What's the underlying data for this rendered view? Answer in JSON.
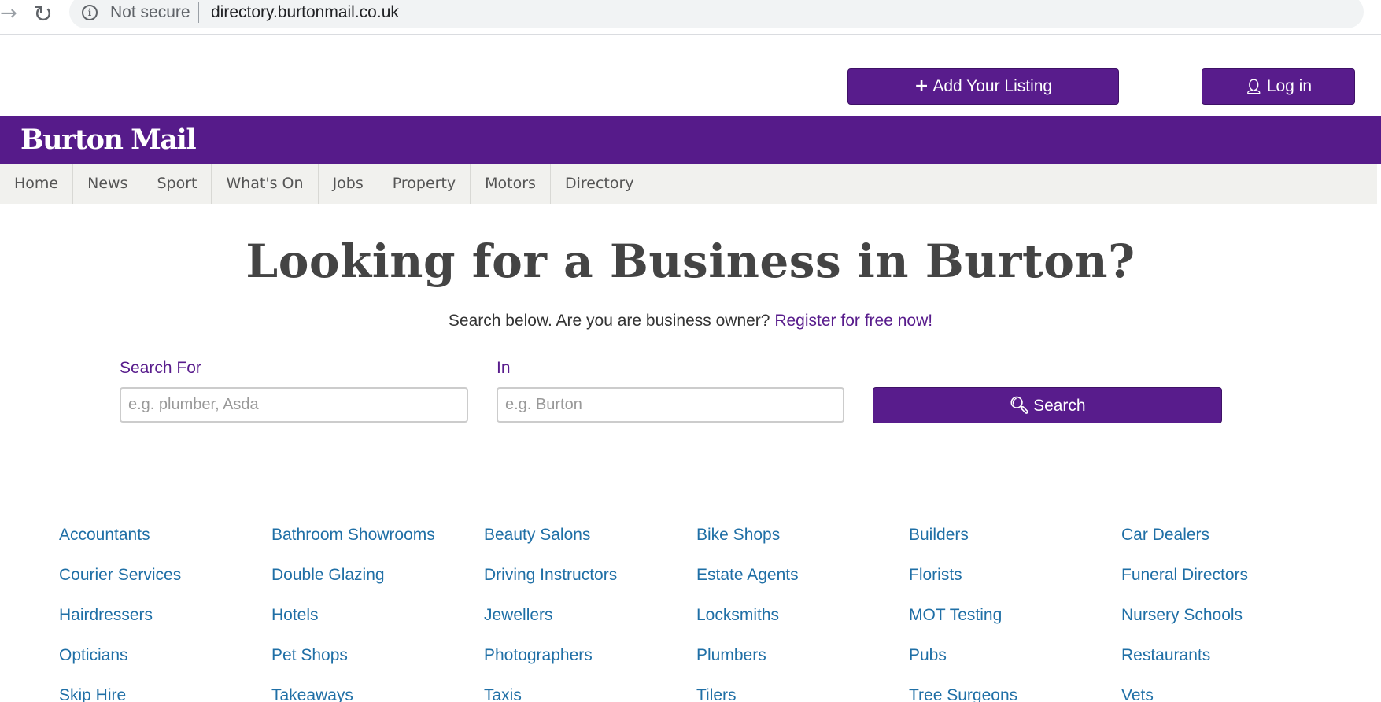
{
  "browser": {
    "security_label": "Not secure",
    "url": "directory.burtonmail.co.uk"
  },
  "header": {
    "add_listing_label": "Add Your Listing",
    "login_label": "Log in",
    "logo_text": "Burton Mail"
  },
  "nav": {
    "items": [
      "Home",
      "News",
      "Sport",
      "What's On",
      "Jobs",
      "Property",
      "Motors",
      "Directory"
    ]
  },
  "hero": {
    "title": "Looking for a Business in Burton?",
    "subtitle": "Search below. Are you are business owner?",
    "register_link": "Register for free now!"
  },
  "search": {
    "for_label": "Search For",
    "for_placeholder": "e.g. plumber, Asda",
    "in_label": "In",
    "in_placeholder": "e.g. Burton",
    "button_label": "Search"
  },
  "categories": [
    "Accountants",
    "Bathroom Showrooms",
    "Beauty Salons",
    "Bike Shops",
    "Builders",
    "Car Dealers",
    "Courier Services",
    "Double Glazing",
    "Driving Instructors",
    "Estate Agents",
    "Florists",
    "Funeral Directors",
    "Hairdressers",
    "Hotels",
    "Jewellers",
    "Locksmiths",
    "MOT Testing",
    "Nursery Schools",
    "Opticians",
    "Pet Shops",
    "Photographers",
    "Plumbers",
    "Pubs",
    "Restaurants",
    "Skip Hire",
    "Takeaways",
    "Taxis",
    "Tilers",
    "Tree Surgeons",
    "Vets"
  ],
  "colors": {
    "brand_purple": "#561b8a",
    "link_blue": "#1f6fa6",
    "nav_bg": "#f1f1ee"
  },
  "icons": {
    "add": "plus-icon",
    "login": "user-icon",
    "search": "search-icon",
    "info": "info-icon",
    "reload": "reload-icon",
    "forward": "forward-arrow-icon"
  }
}
